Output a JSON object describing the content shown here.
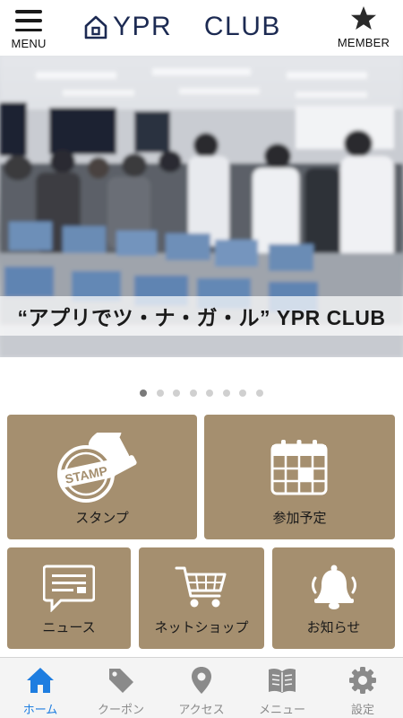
{
  "header": {
    "menu_label": "MENU",
    "logo_text": "YPR  CLUB",
    "member_label": "MEMBER"
  },
  "hero": {
    "caption": "“アプリでツ・ナ・ガ・ル” YPR CLUB",
    "slide_count": 8,
    "active_slide": 1
  },
  "tiles": [
    {
      "label": "スタンプ",
      "icon": "stamp-icon",
      "stamp_text": "STAMP"
    },
    {
      "label": "参加予定",
      "icon": "calendar-icon"
    },
    {
      "label": "ニュース",
      "icon": "news-icon"
    },
    {
      "label": "ネットショップ",
      "icon": "shopping-cart-icon"
    },
    {
      "label": "お知らせ",
      "icon": "bell-icon"
    }
  ],
  "tabbar": [
    {
      "label": "ホーム",
      "icon": "home-icon",
      "active": true
    },
    {
      "label": "クーポン",
      "icon": "coupon-tag-icon",
      "active": false
    },
    {
      "label": "アクセス",
      "icon": "location-pin-icon",
      "active": false
    },
    {
      "label": "メニュー",
      "icon": "menu-book-icon",
      "active": false
    },
    {
      "label": "設定",
      "icon": "settings-gear-icon",
      "active": false
    }
  ],
  "colors": {
    "tile_bg": "#a58f6f",
    "logo_navy": "#1c2a52",
    "tab_active": "#1e7de0",
    "tab_inactive": "#8a8a8a"
  }
}
